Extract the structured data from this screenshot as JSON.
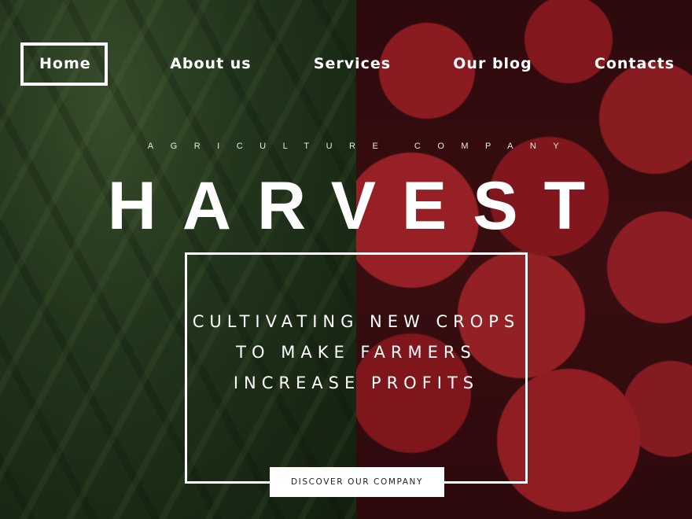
{
  "nav": {
    "items": [
      {
        "label": "Home",
        "active": true
      },
      {
        "label": "About us",
        "active": false
      },
      {
        "label": "Services",
        "active": false
      },
      {
        "label": "Our blog",
        "active": false
      },
      {
        "label": "Contacts",
        "active": false
      }
    ]
  },
  "hero": {
    "kicker": "AGRICULTURE COMPANY",
    "title": "HARVEST",
    "tagline": "CULTIVATING NEW CROPS TO MAKE FARMERS INCREASE PROFITS",
    "cta_label": "DISCOVER OUR COMPANY"
  },
  "background": {
    "left_image": "green-beans-photo",
    "right_image": "strawberries-photo"
  },
  "colors": {
    "text": "#ffffff",
    "button_bg": "#ffffff",
    "button_text": "#222222"
  }
}
